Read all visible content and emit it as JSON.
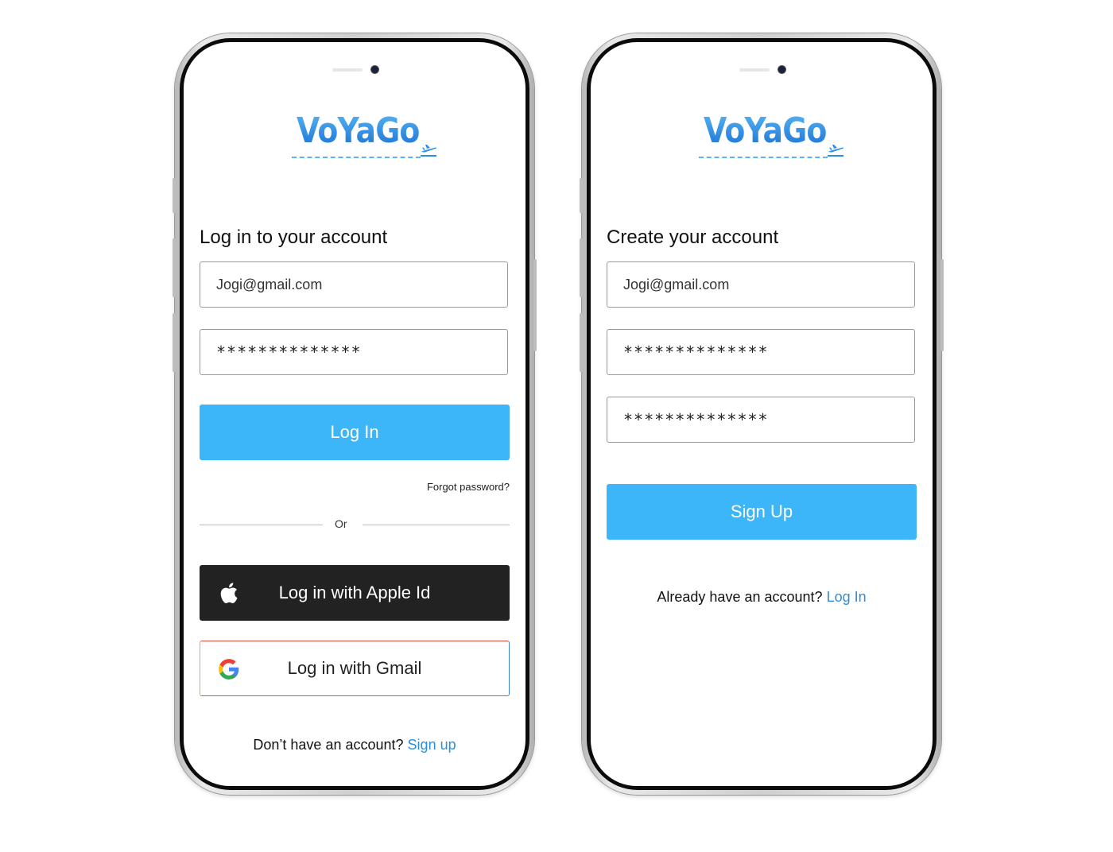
{
  "brand": {
    "name": "VoYaGo",
    "accent_color": "#3cb6f8",
    "link_color": "#2d8fd9"
  },
  "login": {
    "heading": "Log in to your account",
    "email_value": "Jogi@gmail.com",
    "password_value": "**************",
    "login_button": "Log In",
    "forgot_password": "Forgot password?",
    "divider": "Or",
    "apple_button": "Log in with Apple Id",
    "gmail_button": "Log in with Gmail",
    "footer_text": "Don’t have an account?",
    "footer_link": "Sign up"
  },
  "signup": {
    "heading": "Create your account",
    "email_value": "Jogi@gmail.com",
    "password_value": "**************",
    "confirm_password_value": "**************",
    "signup_button": "Sign Up",
    "footer_text": "Already have an account?",
    "footer_link": "Log In"
  },
  "icons": {
    "plane": "airplane-takeoff-icon",
    "apple": "apple-logo-icon",
    "google": "google-logo-icon"
  }
}
